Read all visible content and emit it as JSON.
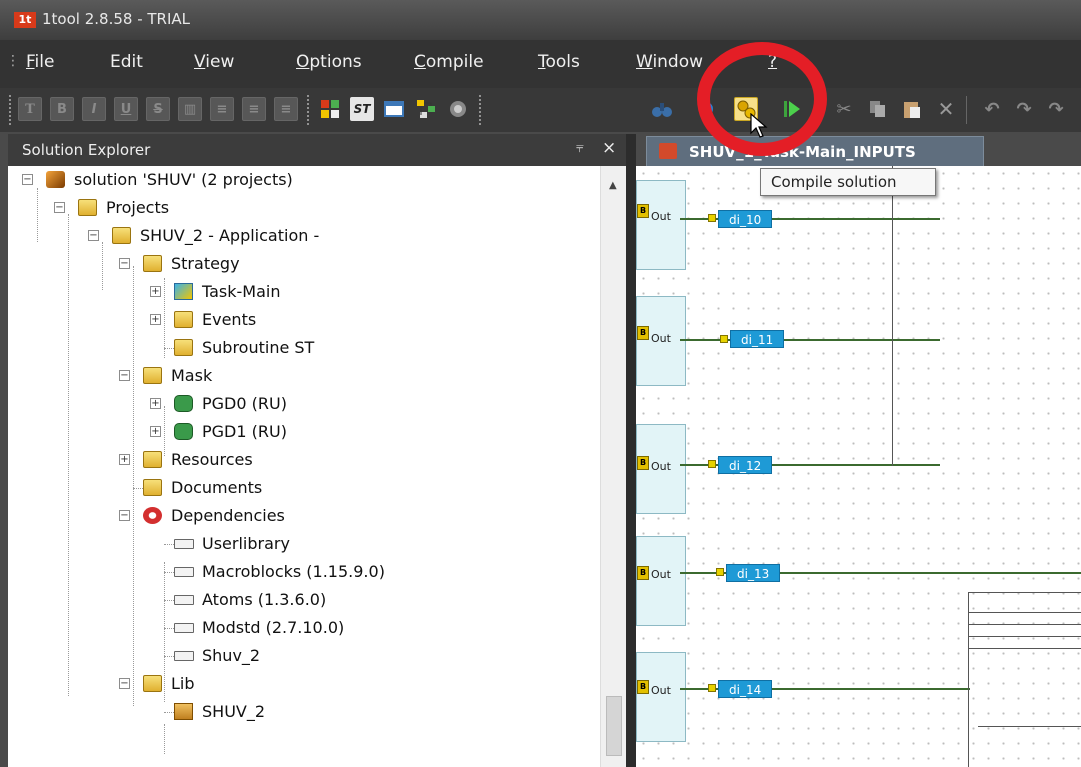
{
  "window": {
    "title": "1tool 2.8.58 - TRIAL",
    "logo_text": "1t"
  },
  "menu": {
    "items": [
      {
        "acc": "F",
        "rest": "ile"
      },
      {
        "acc": "",
        "rest": "Edit"
      },
      {
        "acc": "V",
        "rest": "iew"
      },
      {
        "acc": "O",
        "rest": "ptions"
      },
      {
        "acc": "C",
        "rest": "ompile"
      },
      {
        "acc": "T",
        "rest": "ools"
      },
      {
        "acc": "W",
        "rest": "indow"
      },
      {
        "acc": "?",
        "rest": ""
      }
    ]
  },
  "toolbar": {
    "format_buttons": [
      "T",
      "B",
      "I",
      "U",
      "S",
      "▥",
      "≡",
      "≡",
      "≡"
    ],
    "compile_tooltip": "Compile solution"
  },
  "explorer": {
    "title": "Solution Explorer",
    "pin_glyph": "⫧",
    "close_glyph": "×",
    "tree": [
      {
        "label": "solution 'SHUV' (2 projects)"
      },
      {
        "label": "Projects"
      },
      {
        "label": "SHUV_2  - Application -"
      },
      {
        "label": "Strategy"
      },
      {
        "label": "Task-Main"
      },
      {
        "label": "Events"
      },
      {
        "label": "Subroutine ST"
      },
      {
        "label": "Mask"
      },
      {
        "label": "PGD0 (RU)"
      },
      {
        "label": "PGD1 (RU)"
      },
      {
        "label": "Resources"
      },
      {
        "label": "Documents"
      },
      {
        "label": "Dependencies"
      },
      {
        "label": "Userlibrary"
      },
      {
        "label": "Macroblocks (1.15.9.0)"
      },
      {
        "label": "Atoms (1.3.6.0)"
      },
      {
        "label": "Modstd (2.7.10.0)"
      },
      {
        "label": "Shuv_2"
      },
      {
        "label": "Lib"
      },
      {
        "label": "SHUV_2"
      }
    ]
  },
  "editor": {
    "tab_label": "SHUV_1_Task-Main_INPUTS",
    "blocks": [
      {
        "out": "Out",
        "var": "di_10"
      },
      {
        "out": "Out",
        "var": "di_11"
      },
      {
        "out": "Out",
        "var": "di_12"
      },
      {
        "out": "Out",
        "var": "di_13"
      },
      {
        "out": "Out",
        "var": "di_14"
      }
    ]
  },
  "colors": {
    "annotation": "#e41e26",
    "variable": "#1e9ad6"
  }
}
